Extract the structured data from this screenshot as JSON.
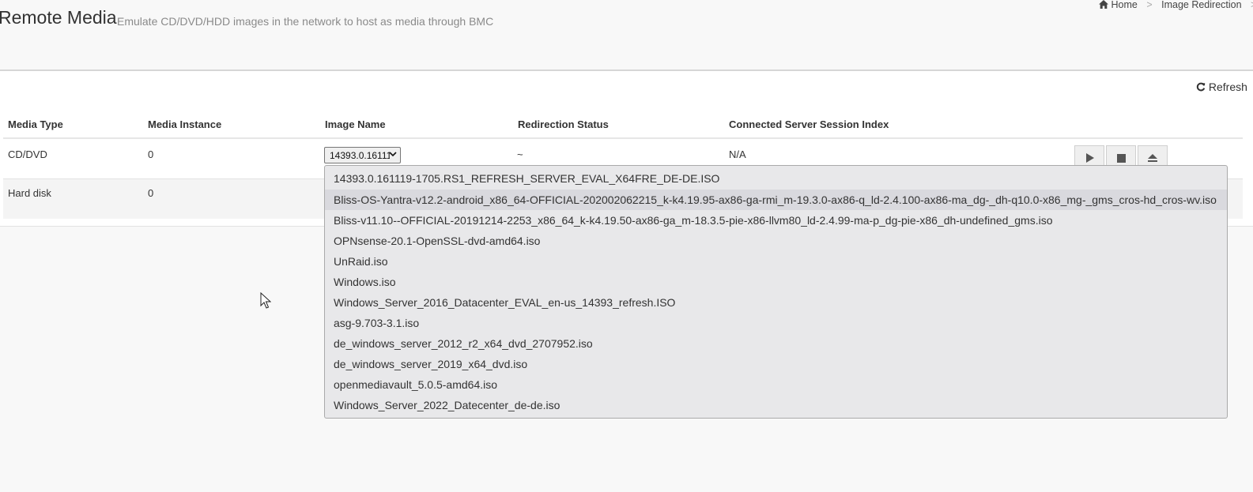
{
  "header": {
    "title": "Remote Media",
    "subtitle": "Emulate CD/DVD/HDD images in the network to host as media through BMC"
  },
  "breadcrumb": {
    "home_icon": "home-icon",
    "home": "Home",
    "sep": ">",
    "current": "Image Redirection",
    "trailing_sep": ">"
  },
  "toolbar": {
    "refresh_icon": "refresh-icon",
    "refresh": "Refresh"
  },
  "table": {
    "columns": [
      "Media Type",
      "Media Instance",
      "Image Name",
      "Redirection Status",
      "Connected Server Session Index"
    ],
    "rows": [
      {
        "media_type": "CD/DVD",
        "instance": "0",
        "image": "14393.0.161119-1705.RS1_REFRESH_SERVER_EVAL_X64FRE_DE-DE.ISO",
        "status": "~",
        "session": "N/A"
      },
      {
        "media_type": "Hard disk",
        "instance": "0"
      }
    ]
  },
  "actions": {
    "start_icon": "play-icon",
    "stop_icon": "stop-icon",
    "eject_icon": "eject-icon"
  },
  "dropdown": {
    "highlighted_index": 1,
    "options": [
      "14393.0.161119-1705.RS1_REFRESH_SERVER_EVAL_X64FRE_DE-DE.ISO",
      "Bliss-OS-Yantra-v12.2-android_x86_64-OFFICIAL-202002062215_k-k4.19.95-ax86-ga-rmi_m-19.3.0-ax86-q_ld-2.4.100-ax86-ma_dg-_dh-q10.0-x86_mg-_gms_cros-hd_cros-wv.iso",
      "Bliss-v11.10--OFFICIAL-20191214-2253_x86_64_k-k4.19.50-ax86-ga_m-18.3.5-pie-x86-llvm80_ld-2.4.99-ma-p_dg-pie-x86_dh-undefined_gms.iso",
      "OPNsense-20.1-OpenSSL-dvd-amd64.iso",
      "UnRaid.iso",
      "Windows.iso",
      "Windows_Server_2016_Datacenter_EVAL_en-us_14393_refresh.ISO",
      "asg-9.703-3.1.iso",
      "de_windows_server_2012_r2_x64_dvd_2707952.iso",
      "de_windows_server_2019_x64_dvd.iso",
      "openmediavault_5.0.5-amd64.iso",
      "Windows_Server_2022_Datecenter_de-de.iso"
    ]
  }
}
